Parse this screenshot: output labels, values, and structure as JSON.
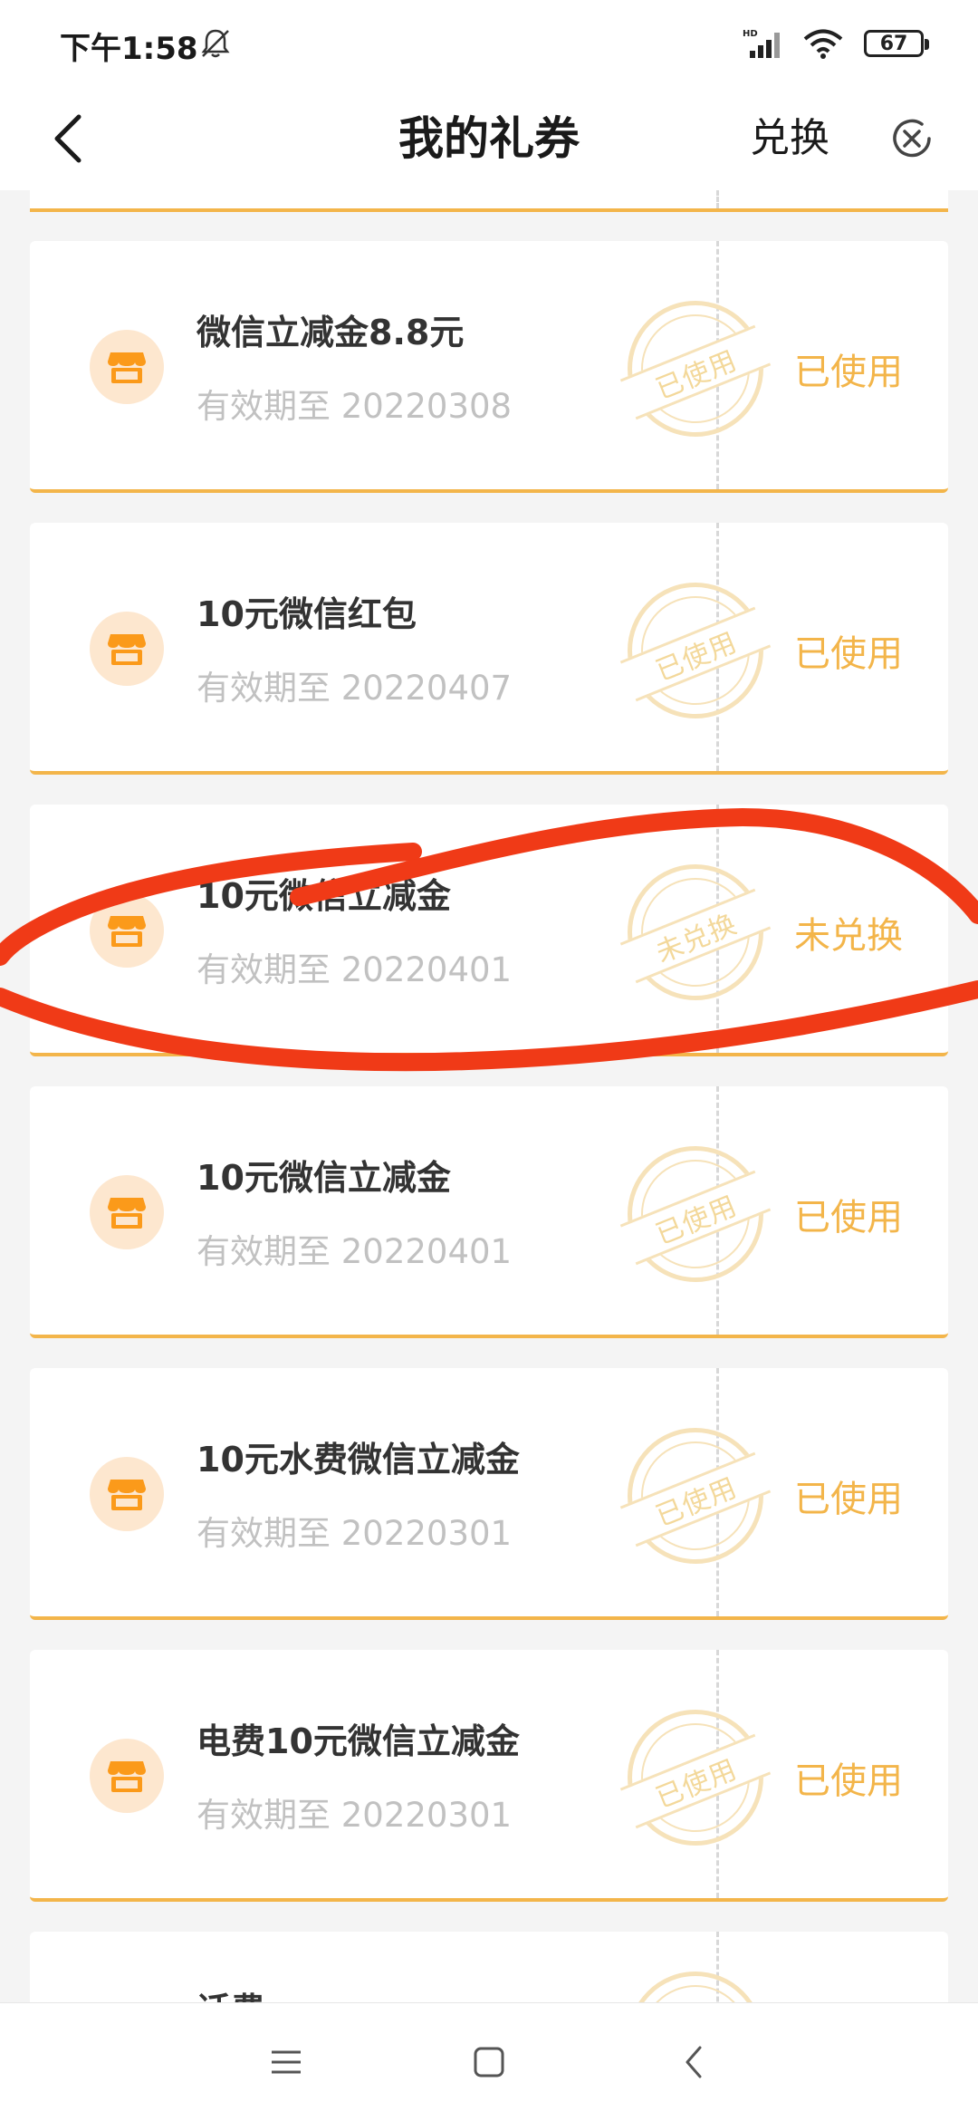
{
  "status_bar": {
    "time": "下午1:58",
    "battery": "67",
    "icons": [
      "bell-off-icon",
      "signal-hd-icon",
      "wifi-icon",
      "battery-icon"
    ]
  },
  "nav": {
    "title": "我的礼券",
    "exchange_label": "兑换",
    "back_icon": "chevron-left-icon",
    "close_icon": "close-circle-icon"
  },
  "coupons": [
    {
      "name": "微信立减金8.8元",
      "expiry": "有效期至 20220308",
      "stamp": "已使用",
      "status": "已使用"
    },
    {
      "name": "10元微信红包",
      "expiry": "有效期至 20220407",
      "stamp": "已使用",
      "status": "已使用"
    },
    {
      "name": "10元微信立减金",
      "expiry": "有效期至 20220401",
      "stamp": "未兑换",
      "status": "未兑换"
    },
    {
      "name": "10元微信立减金",
      "expiry": "有效期至 20220401",
      "stamp": "已使用",
      "status": "已使用"
    },
    {
      "name": "10元水费微信立减金",
      "expiry": "有效期至 20220301",
      "stamp": "已使用",
      "status": "已使用"
    },
    {
      "name": "电费10元微信立减金",
      "expiry": "有效期至 20220301",
      "stamp": "已使用",
      "status": "已使用"
    },
    {
      "name": "话费",
      "expiry": "",
      "stamp": "",
      "status": ""
    }
  ],
  "colors": {
    "accent": "#f3b54a",
    "scribble": "#f03a17",
    "stamp": "#f6e2b9"
  },
  "bottom_nav": [
    "menu-icon",
    "home-square-icon",
    "back-triangle-icon"
  ]
}
